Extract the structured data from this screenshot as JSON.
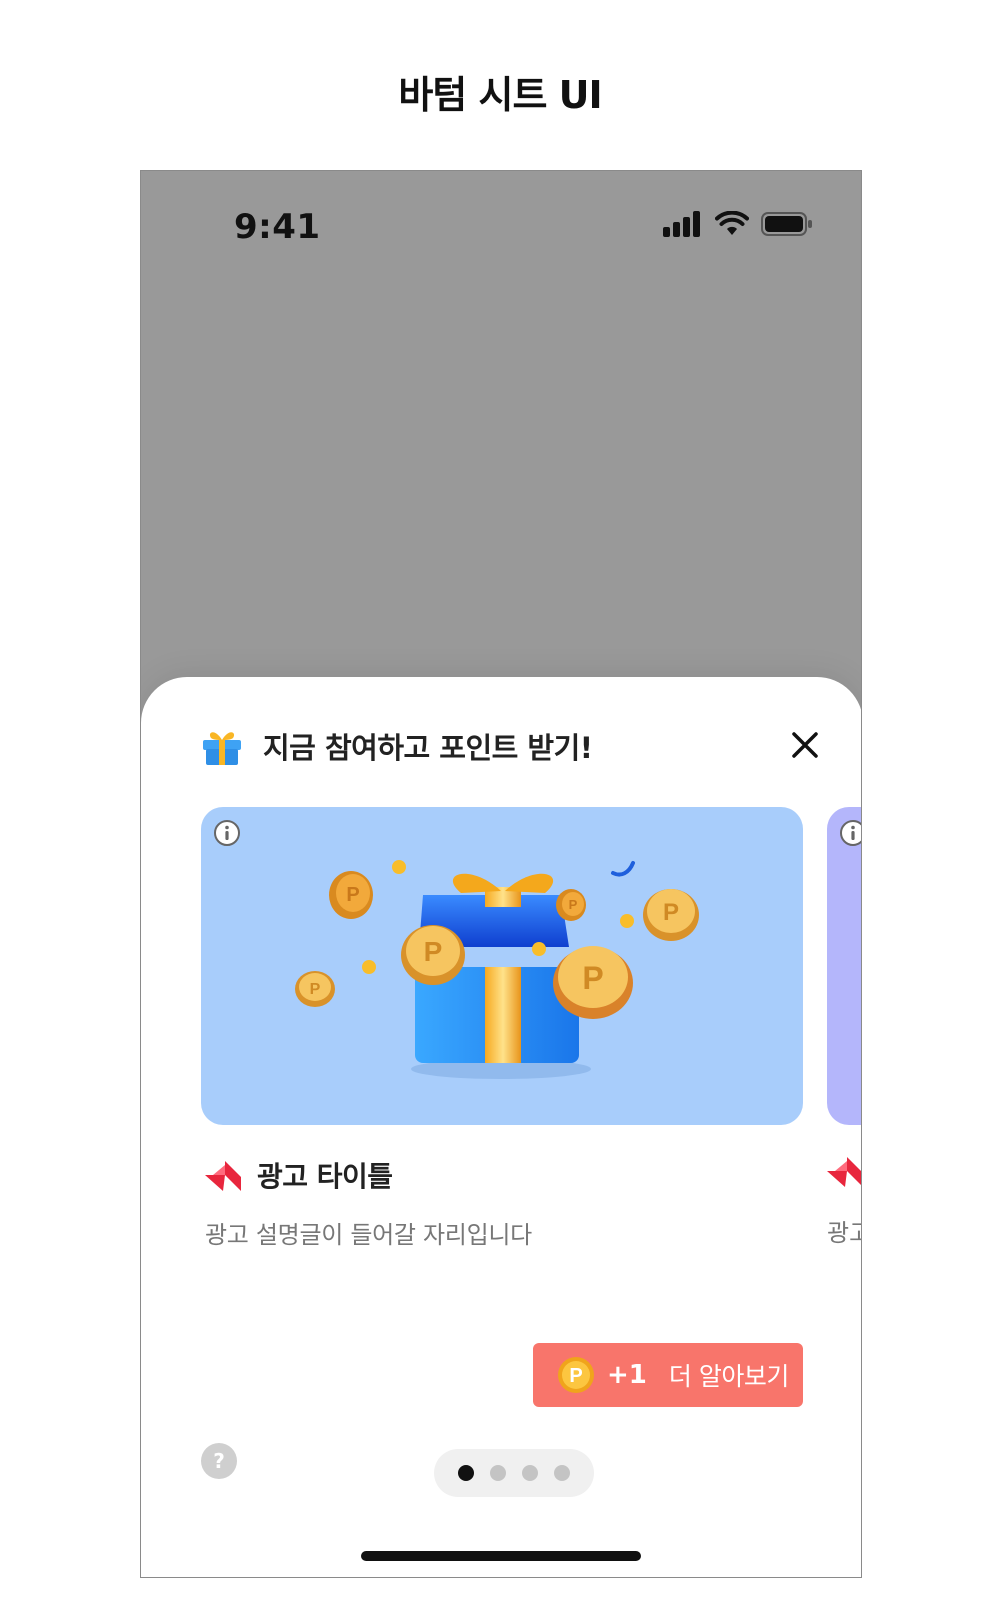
{
  "page": {
    "title": "바텀 시트 UI"
  },
  "status_bar": {
    "time": "9:41",
    "icons": [
      "signal-icon",
      "wifi-icon",
      "battery-icon"
    ]
  },
  "sheet": {
    "header_icon": "gift-icon",
    "title": "지금 참여하고 포인트 받기!",
    "close_icon": "close-icon",
    "ads": [
      {
        "image_background": "#a8cdfb",
        "info_icon": "info-icon",
        "brand_icon": "brand-logo-icon",
        "title": "광고 타이틀",
        "description": "광고 설명글이 들어갈 자리입니다"
      },
      {
        "image_background": "#b4b6fb",
        "info_icon": "info-icon",
        "brand_icon": "brand-logo-icon",
        "description": "광고"
      }
    ],
    "cta": {
      "coin_icon": "point-coin-icon",
      "coin_letter": "P",
      "points": "+1",
      "label": "더 알아보기",
      "color": "#f8756b"
    },
    "help_label": "?",
    "pagination": {
      "total": 4,
      "active_index": 0
    }
  },
  "colors": {
    "backdrop": "#999999",
    "accent": "#f8756b",
    "brand_red": "#e8263d"
  }
}
